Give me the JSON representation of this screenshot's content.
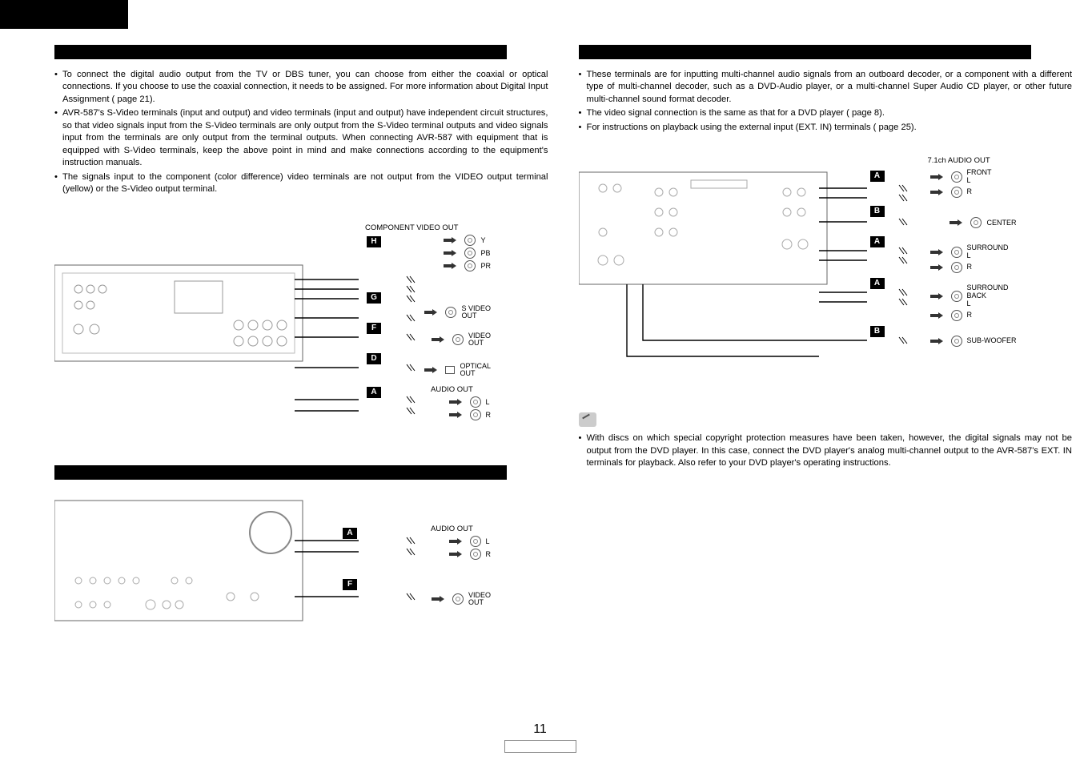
{
  "page_number": "11",
  "left": {
    "bullets": [
      "To connect the digital audio output from the TV or DBS tuner, you can choose from either the coaxial or optical connections. If you choose to use the coaxial connection, it needs to be assigned. For more information about Digital Input Assignment (        page 21).",
      "",
      "AVR-587's S-Video terminals (input and output) and video terminals (input and output) have independent circuit structures, so that video signals input from the S-Video terminals are only output from the S-Video terminal outputs and video signals input from the terminals are only output from the terminal outputs. When connecting AVR-587 with equipment that is equipped with S-Video terminals, keep the above point in mind and make connections according to the equipment's instruction manuals.",
      "The signals input to the component (color difference) video terminals are not output from the VIDEO output terminal (yellow) or the S-Video output terminal."
    ],
    "diagram1": {
      "tags": {
        "H": "H",
        "G": "G",
        "F": "F",
        "D": "D",
        "A": "A"
      },
      "labels": {
        "cvout": "COMPONENT VIDEO OUT",
        "y": "Y",
        "pb": "PB",
        "pr": "PR",
        "svideo": "S VIDEO",
        "svideo_out": "OUT",
        "video": "VIDEO",
        "video_out": "OUT",
        "optical": "OPTICAL",
        "optical_out": "OUT",
        "audio": "AUDIO OUT",
        "l": "L",
        "r": "R"
      }
    },
    "diagram2": {
      "tags": {
        "A": "A",
        "F": "F"
      },
      "labels": {
        "audio": "AUDIO OUT",
        "l": "L",
        "r": "R",
        "video": "VIDEO",
        "video_out": "OUT"
      }
    }
  },
  "right": {
    "bullets_top": [
      "These terminals are for inputting multi-channel audio signals from an outboard decoder, or a component with a different type of multi-channel decoder, such as a DVD-Audio player, or a multi-channel Super Audio CD player, or other future multi-channel sound format decoder.",
      "The video signal connection is the same as that for a DVD player (        page 8).",
      "For instructions on playback using the external input (EXT. IN) terminals (        page 25)."
    ],
    "diagram": {
      "title": "7.1ch AUDIO OUT",
      "tags": {
        "A": "A",
        "B": "B"
      },
      "rows": [
        {
          "tag": "A",
          "group": "FRONT",
          "ch": [
            "L",
            "R"
          ]
        },
        {
          "tag": "B",
          "group": "CENTER",
          "ch": [
            ""
          ]
        },
        {
          "tag": "A",
          "group": "SURROUND",
          "ch": [
            "L",
            "R"
          ]
        },
        {
          "tag": "A",
          "group": "SURROUND BACK",
          "ch": [
            "L",
            "R"
          ]
        },
        {
          "tag": "B",
          "group": "SUB-WOOFER",
          "ch": [
            ""
          ]
        }
      ]
    },
    "note_bullet": "With discs on which special copyright protection measures have been taken, however, the digital signals may not be output from the DVD player. In this case, connect the DVD player's analog multi-channel output to the AVR-587's EXT. IN terminals for playback. Also refer to your DVD player's operating instructions."
  }
}
